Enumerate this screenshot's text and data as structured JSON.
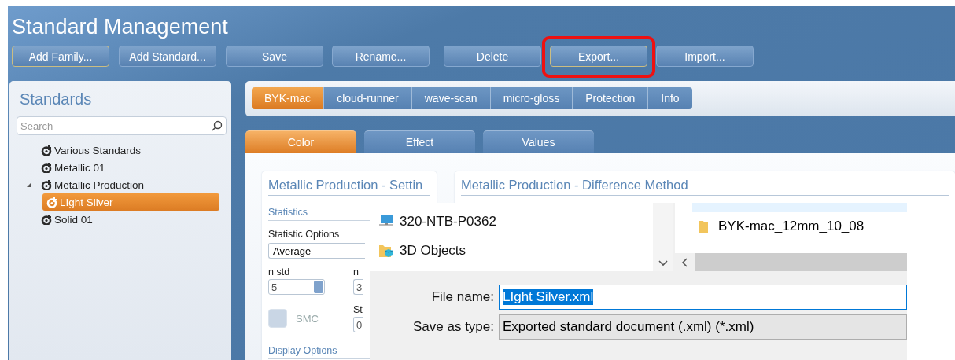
{
  "window": {
    "title": "Standard Management"
  },
  "toolbar": {
    "buttons": [
      {
        "label": "Add Family...",
        "focused": true,
        "highlighted": false
      },
      {
        "label": "Add Standard...",
        "focused": false,
        "highlighted": false
      },
      {
        "label": "Save",
        "focused": false,
        "highlighted": false
      },
      {
        "label": "Rename...",
        "focused": false,
        "highlighted": false
      },
      {
        "label": "Delete",
        "focused": false,
        "highlighted": false
      },
      {
        "label": "Export...",
        "focused": true,
        "highlighted": true
      },
      {
        "label": "Import...",
        "focused": false,
        "highlighted": false
      }
    ]
  },
  "sidebar": {
    "title": "Standards",
    "search": {
      "placeholder": "Search"
    },
    "tree": [
      {
        "label": "Various Standards",
        "selected": false
      },
      {
        "label": "Metallic 01",
        "selected": false
      },
      {
        "label": "Metallic Production",
        "selected": false,
        "expanded": true,
        "children": [
          {
            "label": "LIght Silver",
            "selected": true
          }
        ]
      },
      {
        "label": "Solid 01",
        "selected": false
      }
    ]
  },
  "device_tabs": [
    {
      "label": "BYK-mac",
      "selected": true
    },
    {
      "label": "cloud-runner",
      "selected": false
    },
    {
      "label": "wave-scan",
      "selected": false
    },
    {
      "label": "micro-gloss",
      "selected": false
    },
    {
      "label": "Protection",
      "selected": false
    },
    {
      "label": "Info",
      "selected": false
    }
  ],
  "view_tabs": [
    {
      "label": "Color",
      "selected": true
    },
    {
      "label": "Effect",
      "selected": false
    },
    {
      "label": "Values",
      "selected": false
    }
  ],
  "settings_panel": {
    "title": "Metallic Production - Settin",
    "section": "Statistics",
    "statistic_options": {
      "label": "Statistic Options",
      "value": "Average"
    },
    "n_std": {
      "label": "n std",
      "value": "5"
    },
    "column_2": {
      "label": "n",
      "value": "3",
      "label_2": "St",
      "value_2": "0."
    },
    "smc": {
      "label": "SMC",
      "checked": false
    },
    "section_2": "Display Options"
  },
  "difference_panel": {
    "title": "Metallic Production - Difference Method"
  },
  "save_dialog": {
    "nav_items": [
      {
        "label": "320-NTB-P0362",
        "kind": "computer"
      },
      {
        "label": "3D Objects",
        "kind": "objects"
      }
    ],
    "files": [
      {
        "label": "BYK-mac_12mm_10_08"
      }
    ],
    "file_name": {
      "label": "File name:",
      "value": "LIght Silver.xml"
    },
    "save_as_type": {
      "label": "Save as type:",
      "value": "Exported standard document (.xml) (*.xml)"
    }
  }
}
